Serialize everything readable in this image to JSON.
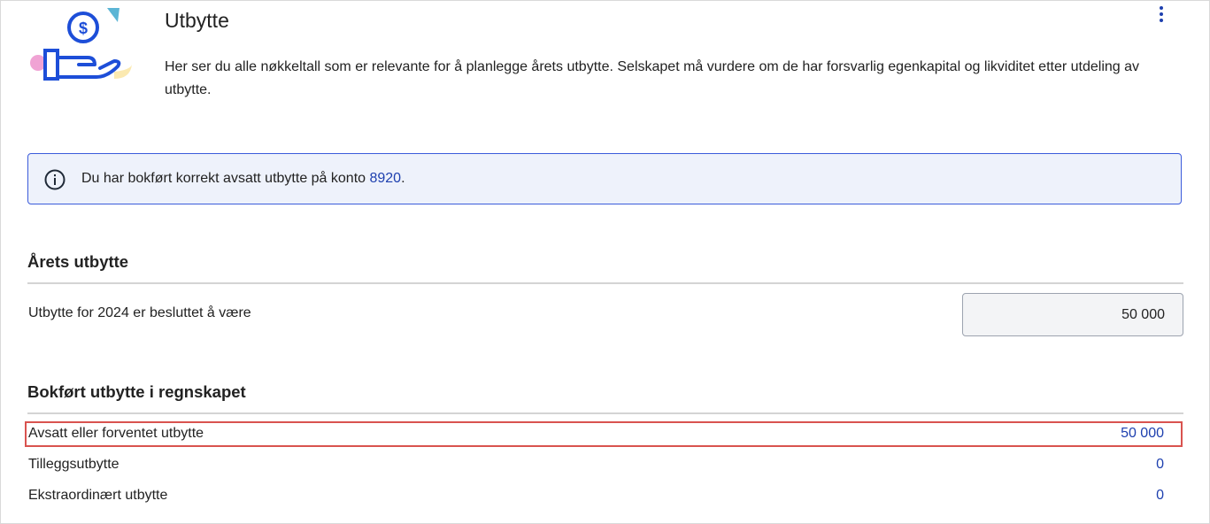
{
  "header": {
    "title": "Utbytte",
    "description": "Her ser du alle nøkkeltall som er relevante for å planlegge årets utbytte. Selskapet må vurdere om de har forsvarlig egenkapital og likviditet etter utdeling av utbytte.",
    "more_icon": "more-vertical-icon",
    "illustration_icon": "hand-holding-coin-icon"
  },
  "info_banner": {
    "icon": "info-circle-icon",
    "text_before": "Du har bokført korrekt avsatt utbytte på konto ",
    "link_text": "8920",
    "text_after": "."
  },
  "arets_utbytte": {
    "heading": "Årets utbytte",
    "label": "Utbytte for 2024 er besluttet å være",
    "value": "50 000"
  },
  "bokfort_utbytte": {
    "heading": "Bokført utbytte i regnskapet",
    "rows": [
      {
        "label": "Avsatt eller forventet utbytte",
        "value": "50 000"
      },
      {
        "label": "Tilleggsutbytte",
        "value": "0"
      },
      {
        "label": "Ekstraordinært utbytte",
        "value": "0"
      }
    ]
  },
  "colors": {
    "accent": "#1e40af",
    "banner_bg": "#eef2fb",
    "banner_border": "#3b5bdb",
    "highlight_border": "#d9534f"
  }
}
